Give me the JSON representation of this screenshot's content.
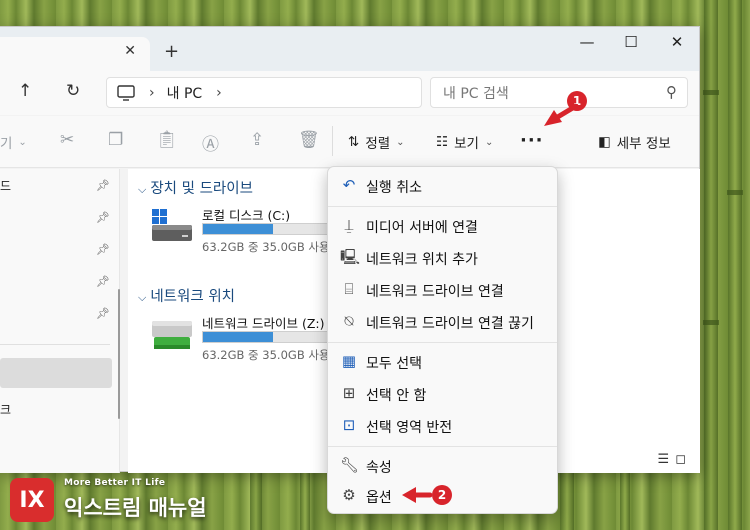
{
  "window": {
    "new_tab": "+",
    "tab_close": "✕",
    "minimize": "—",
    "maximize": "☐",
    "close": "✕"
  },
  "address": {
    "path_root": "내 PC",
    "search_placeholder": "내 PC 검색"
  },
  "toolbar": {
    "view_partial": "기",
    "sort_label": "정렬",
    "view_label": "보기",
    "more_label": "···",
    "details_label": "세부 정보"
  },
  "nav_pane": {
    "items": [
      "드",
      "",
      "",
      "",
      "",
      "크"
    ]
  },
  "content": {
    "groups": [
      {
        "title": "장치 및 드라이브"
      },
      {
        "title": "네트워크 위치"
      }
    ],
    "drives": [
      {
        "name": "로컬 디스크 (C:)",
        "space": "63.2GB 중 35.0GB 사용",
        "used_fraction": 0.55
      },
      {
        "name": "네트워크 드라이브 (Z:)",
        "space": "63.2GB 중 35.0GB 사용",
        "used_fraction": 0.55
      }
    ]
  },
  "menu": {
    "items": [
      {
        "label": "실행 취소",
        "icon": "undo-icon"
      },
      {
        "label": "미디어 서버에 연결",
        "icon": "media-server-icon"
      },
      {
        "label": "네트워크 위치 추가",
        "icon": "network-location-icon"
      },
      {
        "label": "네트워크 드라이브 연결",
        "icon": "map-drive-icon"
      },
      {
        "label": "네트워크 드라이브 연결 끊기",
        "icon": "disconnect-drive-icon"
      },
      {
        "label": "모두 선택",
        "icon": "select-all-icon"
      },
      {
        "label": "선택 안 함",
        "icon": "select-none-icon"
      },
      {
        "label": "선택 영역 반전",
        "icon": "invert-selection-icon"
      },
      {
        "label": "속성",
        "icon": "properties-wrench-icon"
      },
      {
        "label": "옵션",
        "icon": "options-gear-icon"
      }
    ]
  },
  "markers": {
    "step1": "1",
    "step2": "2"
  },
  "brand": {
    "logo": "IX",
    "tagline": "More Better IT Life",
    "name": "익스트림 매뉴얼"
  },
  "colors": {
    "accent_blue": "#3d8fd6",
    "group_header": "#1a4a7e",
    "marker_red": "#d8242b"
  }
}
